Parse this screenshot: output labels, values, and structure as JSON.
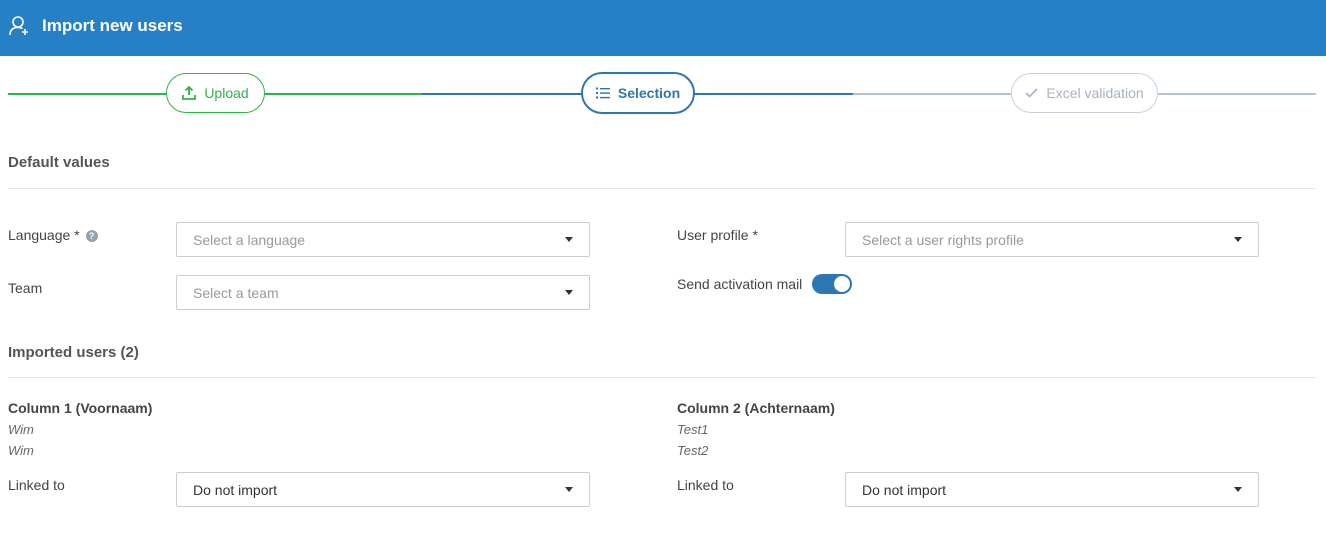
{
  "header": {
    "title": "Import new users",
    "icon": "user-plus-icon",
    "background": "#2680c6"
  },
  "stepper": {
    "steps": [
      {
        "label": "Upload",
        "icon": "upload-icon",
        "state": "done",
        "color": "#2fb34a"
      },
      {
        "label": "Selection",
        "icon": "list-icon",
        "state": "active",
        "color": "#2e76b1"
      },
      {
        "label": "Excel validation",
        "icon": "check-icon",
        "state": "pending",
        "color": "#a7b3c0"
      }
    ]
  },
  "defaults": {
    "title": "Default values",
    "language": {
      "label": "Language *",
      "placeholder": "Select a language"
    },
    "team": {
      "label": "Team",
      "placeholder": "Select a team"
    },
    "user_profile": {
      "label": "User profile *",
      "placeholder": "Select a user rights profile"
    },
    "activation": {
      "label": "Send activation mail",
      "enabled": true
    }
  },
  "imported": {
    "title": "Imported users (2)",
    "columns": [
      {
        "header": "Column 1 (Voornaam)",
        "values": [
          "Wim",
          "Wim"
        ],
        "linked_label": "Linked to",
        "linked_value": "Do not import"
      },
      {
        "header": "Column 2 (Achternaam)",
        "values": [
          "Test1",
          "Test2"
        ],
        "linked_label": "Linked to",
        "linked_value": "Do not import"
      }
    ]
  }
}
